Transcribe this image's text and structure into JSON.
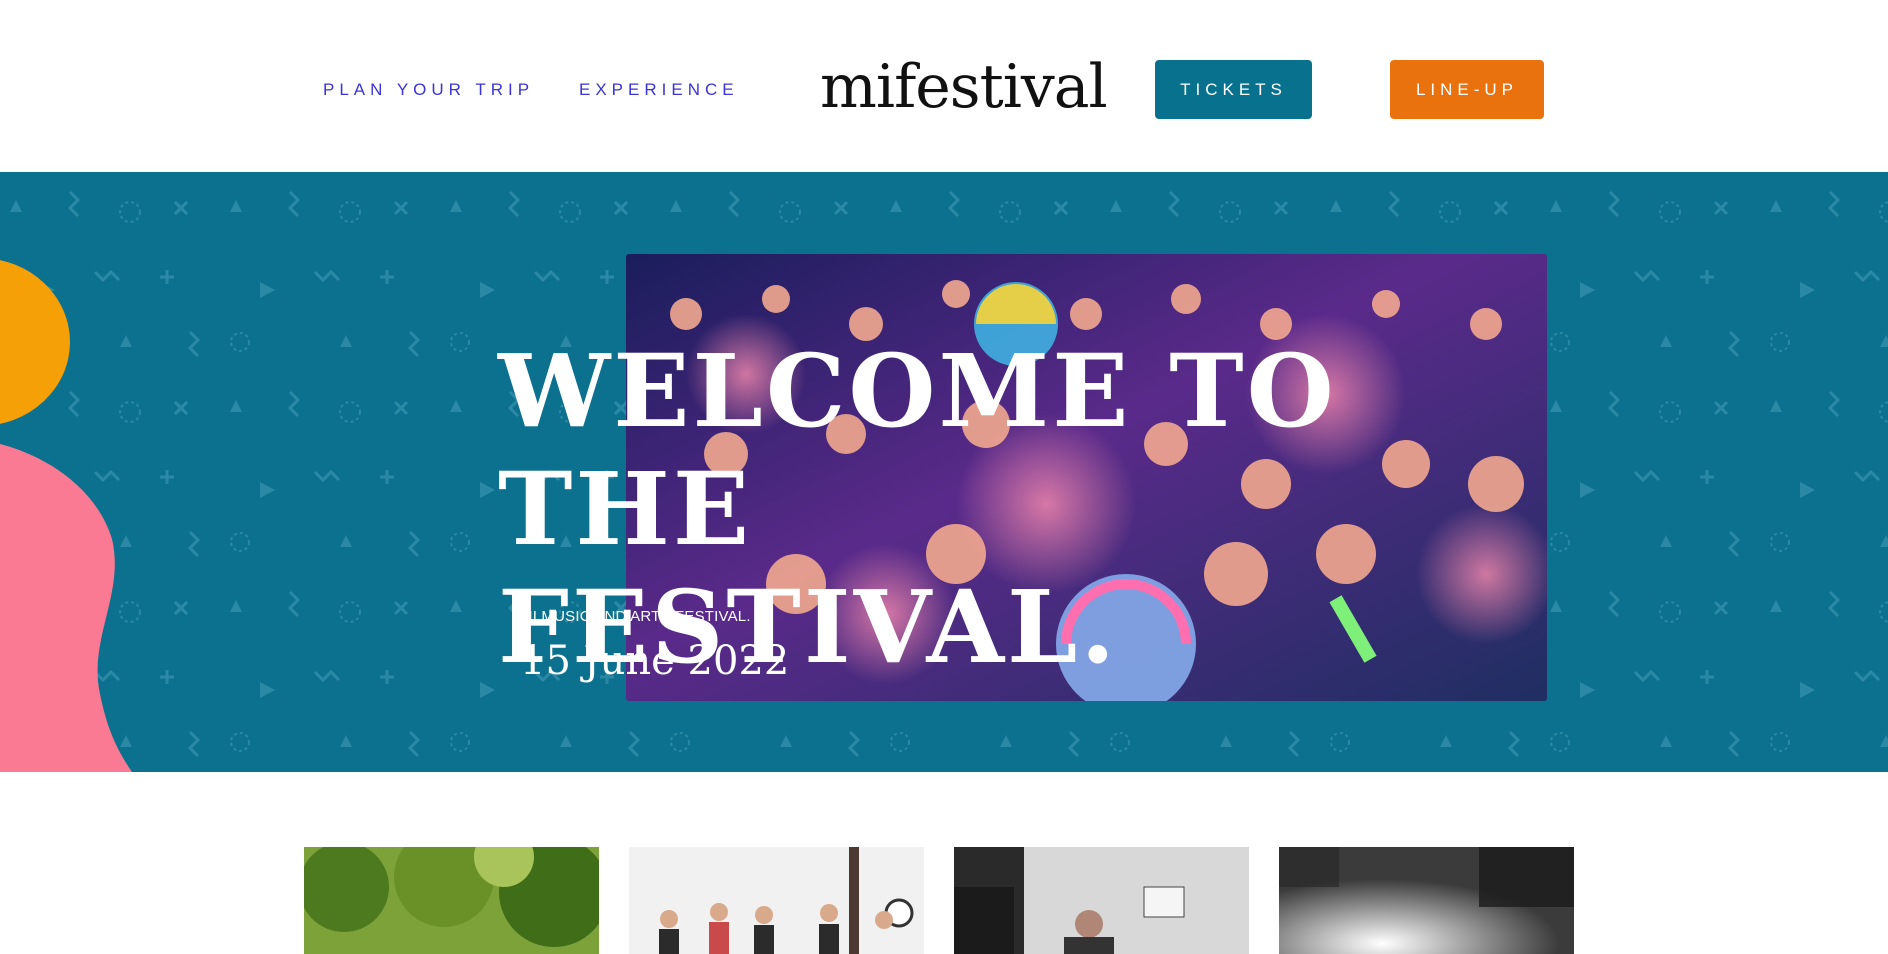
{
  "header": {
    "nav": [
      {
        "label": "PLAN YOUR TRIP"
      },
      {
        "label": "EXPERIENCE"
      }
    ],
    "logo": "mifestival",
    "buttons": {
      "tickets": "TICKETS",
      "lineup": "LINE-UP"
    }
  },
  "hero": {
    "title": "WELCOME TO\nTHE FESTIVAL.",
    "subtitle": "MI MUSIC AND ARTS FESTIVAL.",
    "date": "15 June 2022"
  },
  "colors": {
    "nav_link": "#3b34d6",
    "tickets_button": "#08718e",
    "lineup_button": "#e9720e",
    "hero_background": "#0c718e",
    "accent_orange": "#f6a007",
    "accent_pink": "#f97a92"
  },
  "icons": [
    "festival-logo",
    "crowd-photo",
    "forest-photo",
    "fitness-class-photo",
    "food-vendor-photo",
    "stage-lights-photo"
  ]
}
